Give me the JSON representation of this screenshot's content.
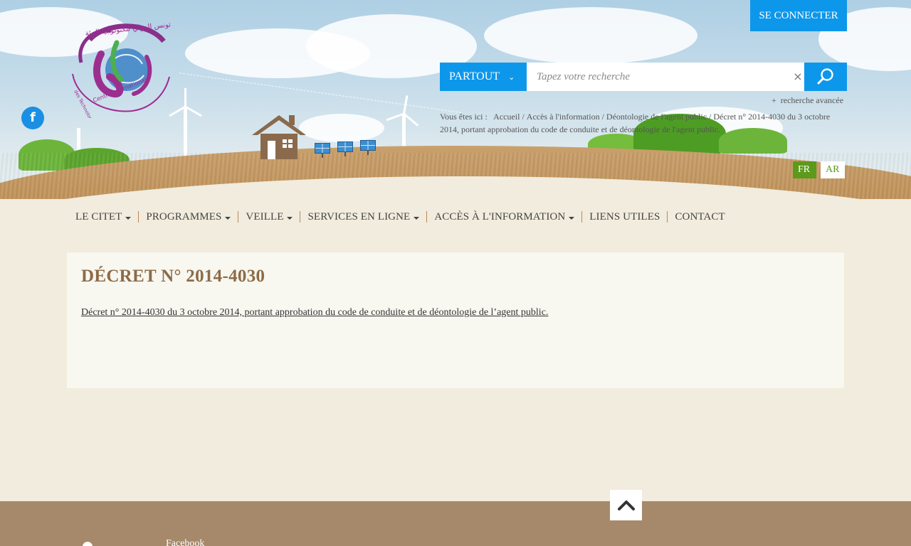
{
  "header": {
    "connect_label": "SE CONNECTER",
    "logo_text_fr_line1": "Centre International",
    "logo_text_fr_line2": "des Technologies de l'Environnement de Tunis",
    "logo_text_ar": "مركز تونس الدولي لتكنولوجيا البيئة",
    "search": {
      "scope_label": "PARTOUT",
      "placeholder": "Tapez votre recherche",
      "clear_glyph": "×"
    },
    "advanced_search": "recherche avancée",
    "breadcrumb": {
      "prefix": "Vous êtes ici :",
      "items": [
        "Accueil",
        "Accès à l'information",
        "Déontologie de l'agent public",
        "Décret n° 2014-4030 du 3 octobre 2014, portant approbation du code de conduite et de déontologie de l'agent public."
      ]
    },
    "languages": [
      "FR",
      "AR"
    ],
    "active_language": "FR"
  },
  "nav": {
    "items": [
      {
        "label": "LE CITET",
        "dropdown": true
      },
      {
        "label": "PROGRAMMES",
        "dropdown": true
      },
      {
        "label": "VEILLE",
        "dropdown": true
      },
      {
        "label": "SERVICES EN LIGNE",
        "dropdown": true
      },
      {
        "label": "ACCÈS À L'INFORMATION",
        "dropdown": true
      },
      {
        "label": "LIENS UTILES",
        "dropdown": false
      },
      {
        "label": "CONTACT",
        "dropdown": false
      }
    ]
  },
  "main": {
    "title": "DÉCRET N° 2014-4030",
    "link_text": "Décret n° 2014-4030 du 3 octobre 2014, portant approbation du code de conduite et de déontologie de l’agent public."
  },
  "footer": {
    "facebook_label": "Facebook"
  },
  "icons": {
    "facebook": "facebook-icon",
    "search": "search-icon",
    "scroll_top": "chevron-up-icon",
    "dropdown": "caret-down-icon"
  },
  "colors": {
    "accent_blue": "#0d97eb",
    "lang_green": "#5b9a1a",
    "title_brown": "#8c6b48",
    "footer_brown": "#a6896b",
    "page_bg": "#f1ecdd"
  }
}
